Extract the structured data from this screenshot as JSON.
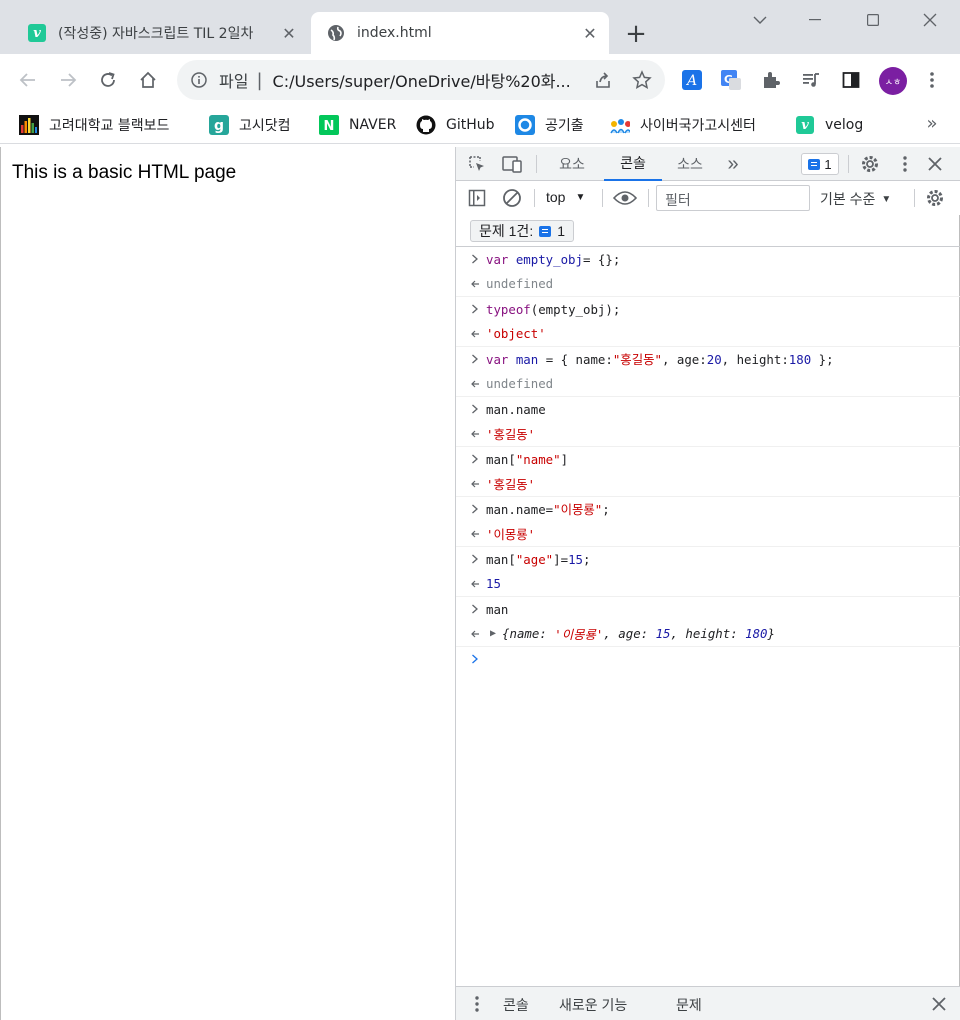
{
  "browser": {
    "tabs": [
      {
        "title": "(작성중) 자바스크립트 TIL 2일차",
        "favicon": "velog-icon",
        "active": false
      },
      {
        "title": "index.html",
        "favicon": "globe-icon",
        "active": true
      }
    ],
    "address": {
      "scheme_label": "파일",
      "url": "C:/Users/super/OneDrive/바탕%20화..."
    },
    "avatar_initials": "ㅅㅎ",
    "bookmarks": [
      {
        "label": "고려대학교 블랙보드",
        "icon": "blackboard-icon"
      },
      {
        "label": "고시닷컴",
        "icon": "gosi-icon"
      },
      {
        "label": "NAVER",
        "icon": "naver-icon"
      },
      {
        "label": "GitHub",
        "icon": "github-icon"
      },
      {
        "label": "공기출",
        "icon": "gonggi-icon"
      },
      {
        "label": "사이버국가고시센터",
        "icon": "cyber-gosi-icon"
      },
      {
        "label": "velog",
        "icon": "velog-icon"
      }
    ],
    "bookmarks_more": "»"
  },
  "page": {
    "body_text": "This is a basic HTML page"
  },
  "devtools": {
    "tabs": [
      "요소",
      "콘솔",
      "소스"
    ],
    "active_tab": "콘솔",
    "more_tabs": "»",
    "issue_count": "1",
    "context": "top",
    "filter_placeholder": "필터",
    "level_label": "기본 수준",
    "issues_label": "문제 1건:",
    "issues_count": "1",
    "console": [
      {
        "input": [
          [
            "kw",
            "var "
          ],
          [
            "vr",
            "empty_obj"
          ],
          [
            "",
            "= {};"
          ]
        ],
        "output": [
          [
            "undef",
            "undefined"
          ]
        ]
      },
      {
        "input": [
          [
            "kw",
            "typeof"
          ],
          [
            "",
            "(empty_obj);"
          ]
        ],
        "output": [
          [
            "str",
            "'object'"
          ]
        ]
      },
      {
        "input": [
          [
            "kw",
            "var "
          ],
          [
            "vr",
            "man"
          ],
          [
            "",
            " = { name:"
          ],
          [
            "str",
            "\"홍길동\""
          ],
          [
            "",
            ", age:"
          ],
          [
            "num",
            "20"
          ],
          [
            "",
            ", height:"
          ],
          [
            "num",
            "180"
          ],
          [
            "",
            " };"
          ]
        ],
        "output": [
          [
            "undef",
            "undefined"
          ]
        ]
      },
      {
        "input": [
          [
            "",
            "man.name"
          ]
        ],
        "output": [
          [
            "str",
            "'홍길동'"
          ]
        ]
      },
      {
        "input": [
          [
            "",
            "man["
          ],
          [
            "str",
            "\"name\""
          ],
          [
            "",
            "]"
          ]
        ],
        "output": [
          [
            "str",
            "'홍길동'"
          ]
        ]
      },
      {
        "input": [
          [
            "",
            "man.name="
          ],
          [
            "str",
            "\"이몽룡\""
          ],
          [
            "",
            ";"
          ]
        ],
        "output": [
          [
            "str",
            "'이몽룡'"
          ]
        ]
      },
      {
        "input": [
          [
            "",
            "man["
          ],
          [
            "str",
            "\"age\""
          ],
          [
            "",
            "]="
          ],
          [
            "num",
            "15"
          ],
          [
            "",
            ";"
          ]
        ],
        "output": [
          [
            "num",
            "15"
          ]
        ]
      },
      {
        "input": [
          [
            "",
            "man"
          ]
        ],
        "output": [
          [
            "obj",
            "{name: "
          ],
          [
            "objstr",
            "'이몽룡'"
          ],
          [
            "obj",
            ", age: "
          ],
          [
            "objnum",
            "15"
          ],
          [
            "obj",
            ", height: "
          ],
          [
            "objnum",
            "180"
          ],
          [
            "obj",
            "}"
          ]
        ]
      }
    ],
    "drawer_tabs": [
      "콘솔",
      "새로운 기능",
      "문제"
    ]
  }
}
